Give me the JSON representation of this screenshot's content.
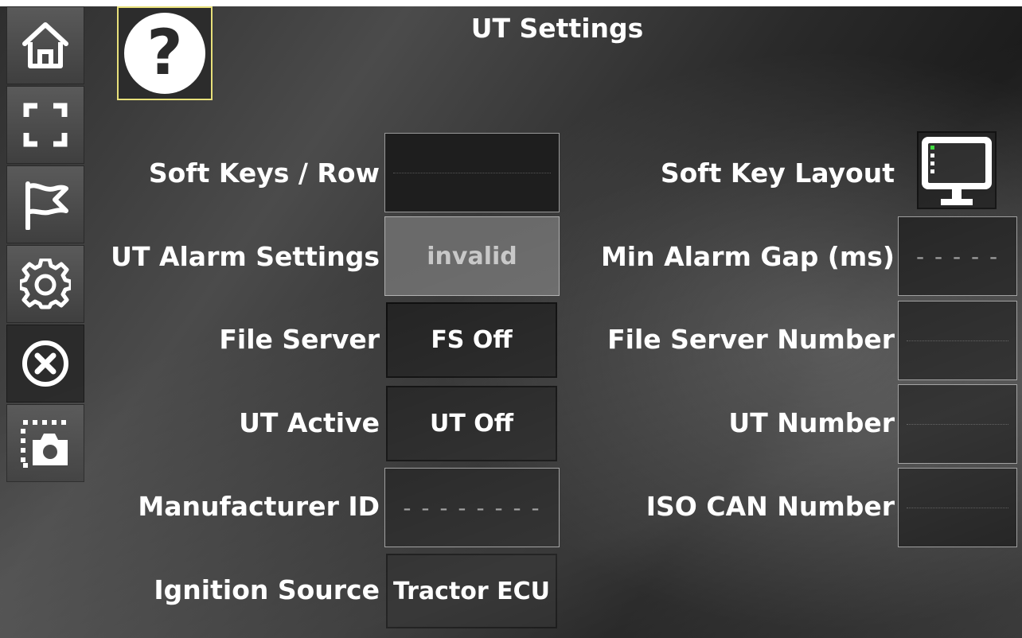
{
  "header": {
    "title": "UT Settings"
  },
  "sidebar": {
    "items": [
      {
        "name": "home",
        "icon": "home-icon"
      },
      {
        "name": "fullscreen",
        "icon": "fullscreen-icon"
      },
      {
        "name": "flag",
        "icon": "flag-icon"
      },
      {
        "name": "settings",
        "icon": "gear-icon"
      },
      {
        "name": "close",
        "icon": "close-circle-icon",
        "active": true
      },
      {
        "name": "screenshot",
        "icon": "camera-icon"
      }
    ]
  },
  "help": {
    "label": "?"
  },
  "left": {
    "soft_keys_row": {
      "label": "Soft Keys / Row",
      "value": ""
    },
    "ut_alarm_settings": {
      "label": "UT Alarm Settings",
      "value": "invalid"
    },
    "file_server": {
      "label": "File Server",
      "value": "FS Off"
    },
    "ut_active": {
      "label": "UT Active",
      "value": "UT Off"
    },
    "manufacturer_id": {
      "label": "Manufacturer ID",
      "value": "- - - - - - - -"
    },
    "ignition_source": {
      "label": "Ignition Source",
      "value": "Tractor ECU"
    }
  },
  "right": {
    "soft_key_layout": {
      "label": "Soft Key Layout",
      "icon": "monitor-layout-icon"
    },
    "min_alarm_gap": {
      "label": "Min Alarm Gap (ms)",
      "value": "- - - - -"
    },
    "file_server_number": {
      "label": "File Server Number",
      "value": ""
    },
    "ut_number": {
      "label": "UT Number",
      "value": ""
    },
    "iso_can_number": {
      "label": "ISO CAN Number",
      "value": ""
    }
  },
  "colors": {
    "help_border": "#e8e07a",
    "layout_indicator": "#3fdc3f"
  }
}
